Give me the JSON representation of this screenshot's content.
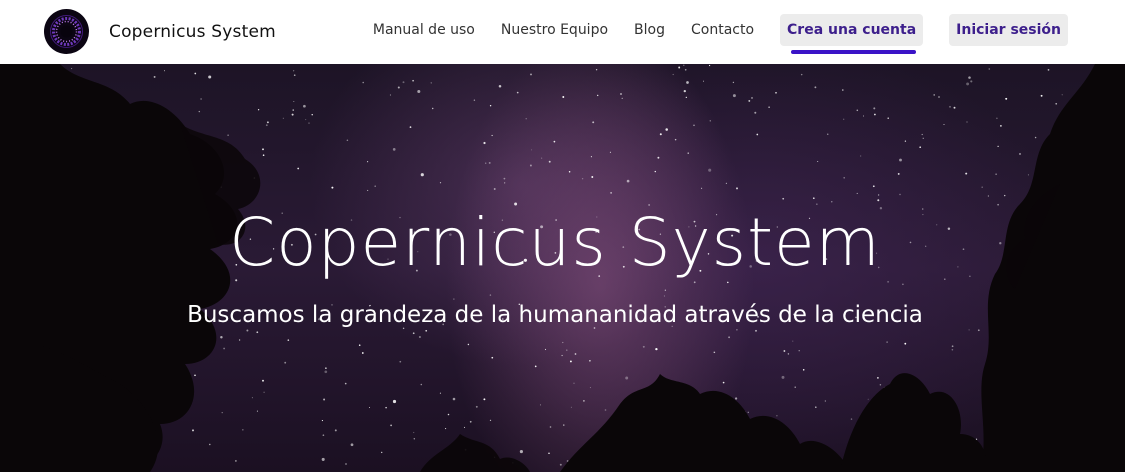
{
  "brand": {
    "name": "Copernicus System",
    "logo_icon": "galaxy-ring-icon"
  },
  "nav": {
    "links": [
      "Manual de uso",
      "Nuestro Equipo",
      "Blog",
      "Contacto"
    ],
    "signup_label": "Crea una cuenta",
    "login_label": "Iniciar sesión"
  },
  "hero": {
    "title": "Copernicus System",
    "subtitle": "Buscamos la grandeza de la humananidad através de la ciencia",
    "background": "starry-night-sky-with-trees"
  },
  "colors": {
    "accent": "#3a13c7",
    "button_text": "#3d1f8c",
    "button_bg": "#ececec",
    "nav_bg": "#ffffff"
  }
}
